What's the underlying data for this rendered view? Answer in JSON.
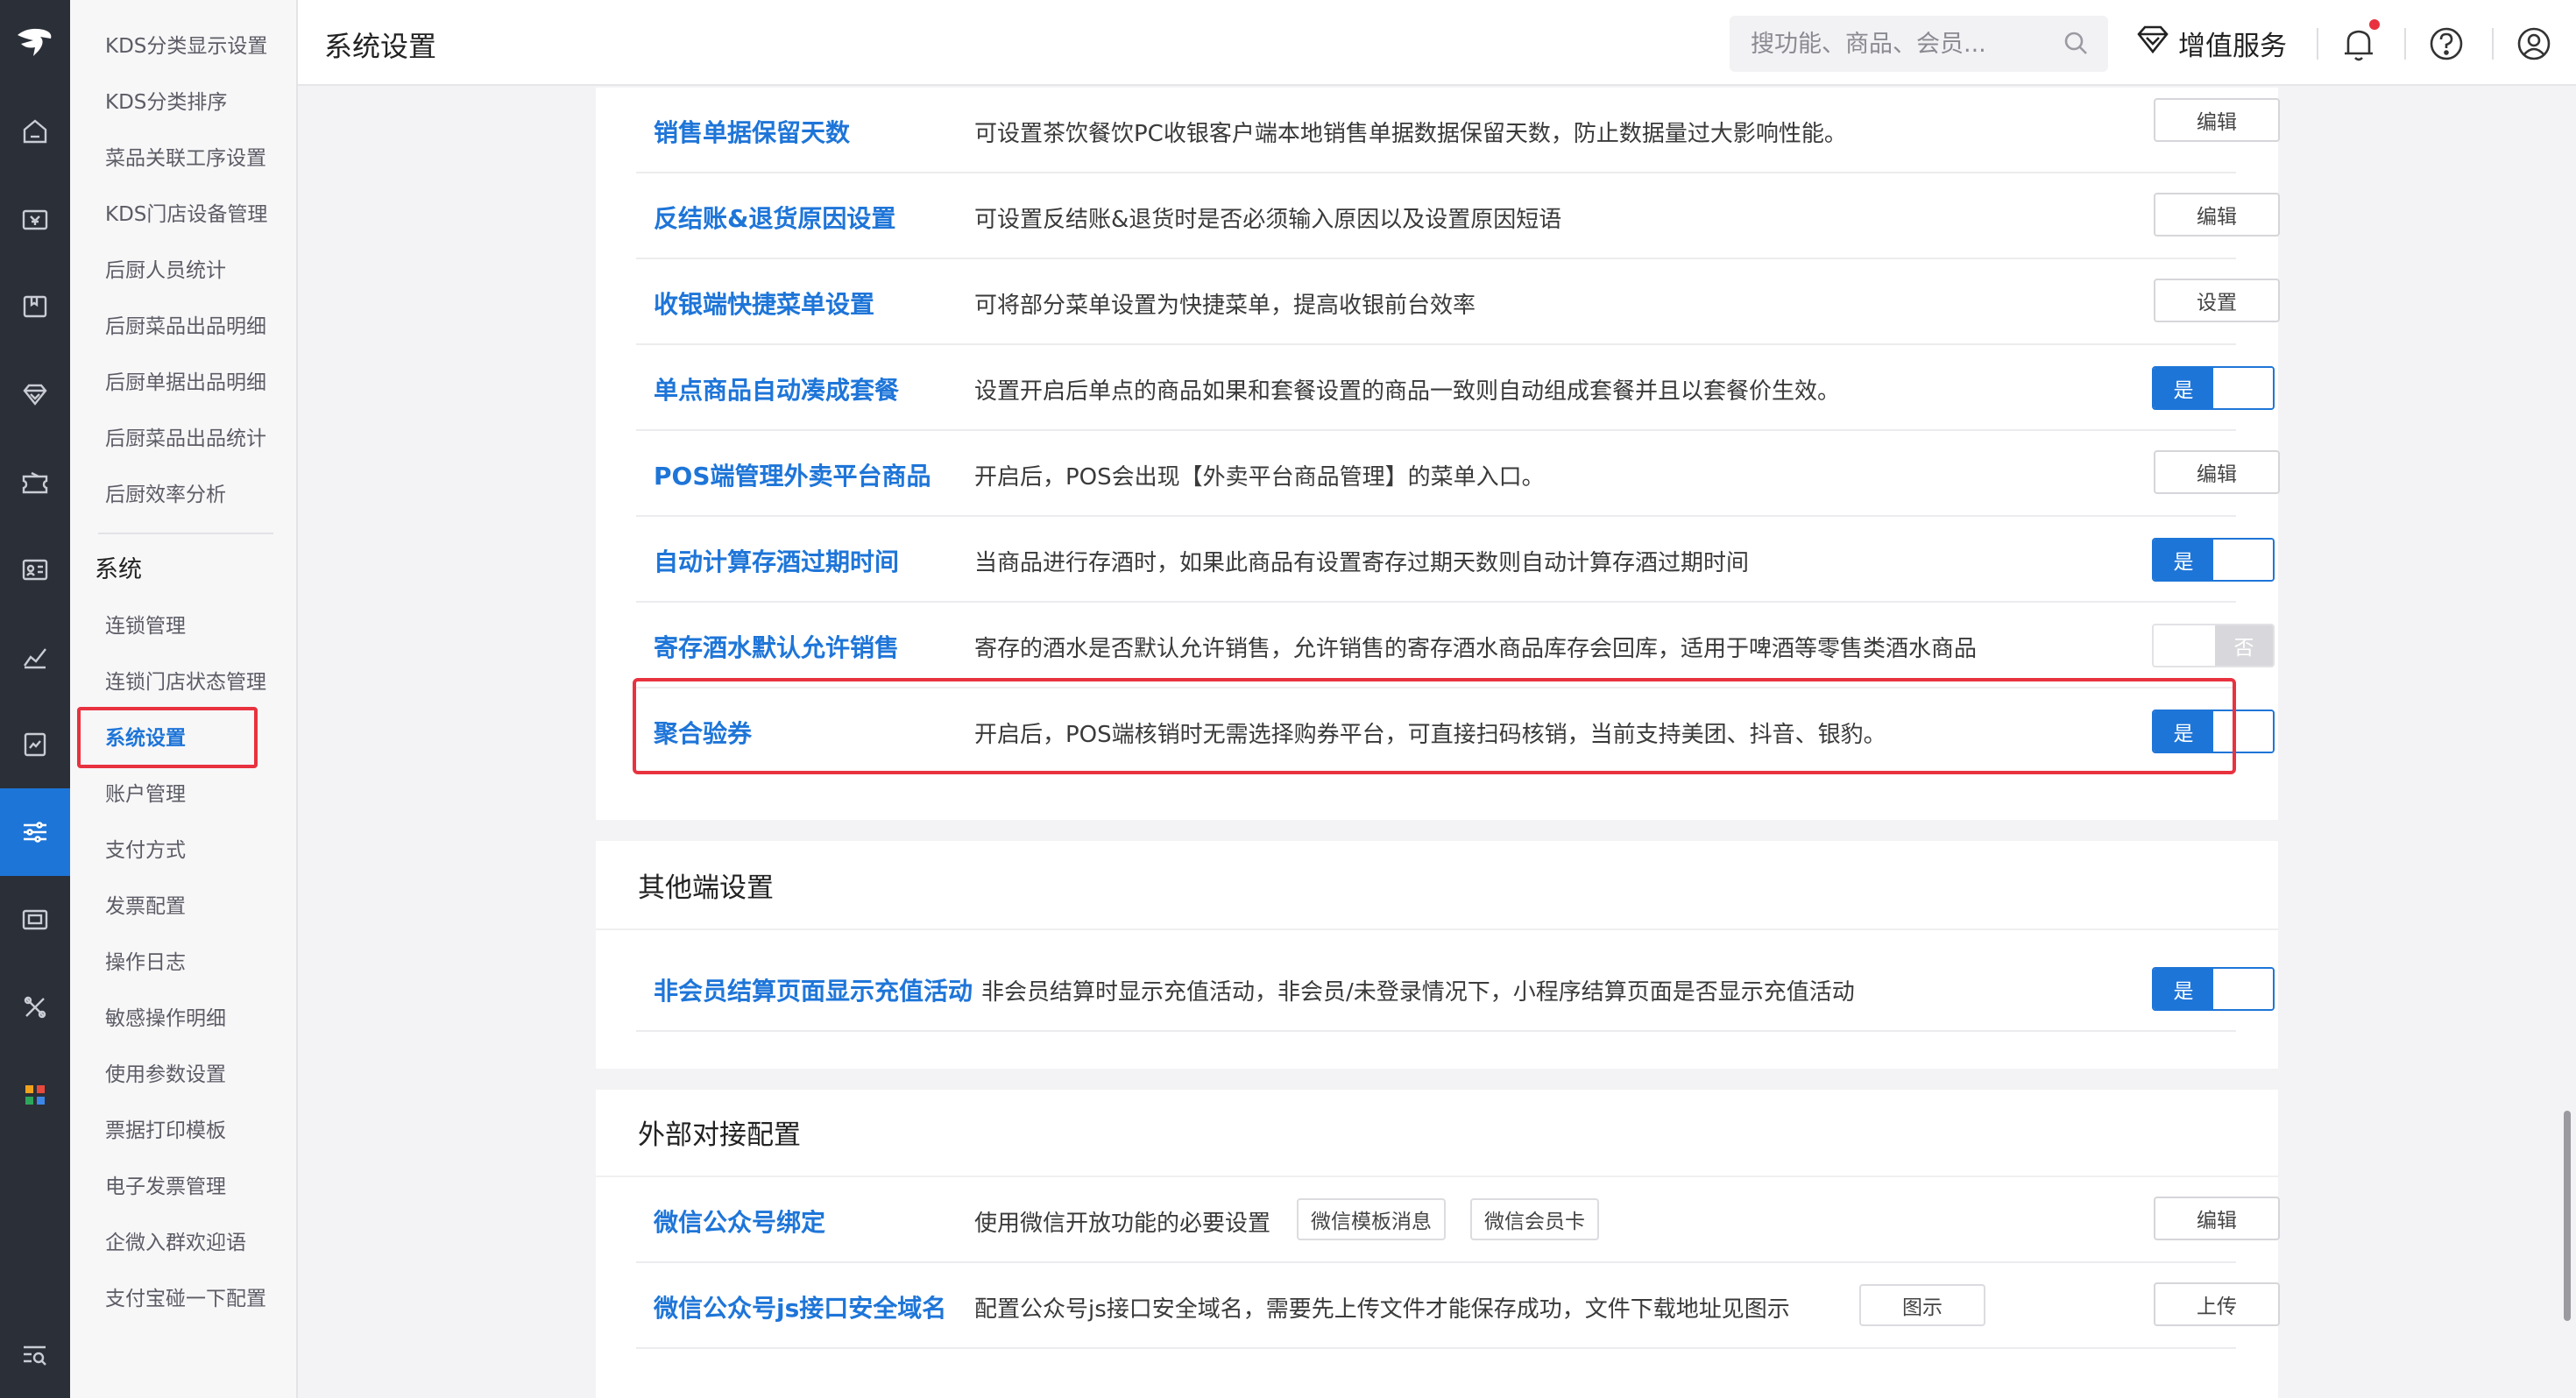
{
  "header": {
    "title": "系统设置",
    "search_placeholder": "搜功能、商品、会员...",
    "value_added_label": "增值服务"
  },
  "rail": {
    "icons": [
      "logo-icon",
      "home-icon",
      "cashier-icon",
      "menu-book-icon",
      "member-diamond-icon",
      "marketing-coupon-icon",
      "report-card-icon",
      "analytics-chart-icon",
      "finance-doc-icon",
      "settings-sliders-icon",
      "device-icon",
      "tools-icon",
      "apps-grid-icon",
      "search-list-icon"
    ]
  },
  "submenu": {
    "kitchen_items": [
      "KDS分类显示设置",
      "KDS分类排序",
      "菜品关联工序设置",
      "KDS门店设备管理",
      "后厨人员统计",
      "后厨菜品出品明细",
      "后厨单据出品明细",
      "后厨菜品出品统计",
      "后厨效率分析"
    ],
    "system_title": "系统",
    "system_items": [
      "连锁管理",
      "连锁门店状态管理",
      "系统设置",
      "账户管理",
      "支付方式",
      "发票配置",
      "操作日志",
      "敏感操作明细",
      "使用参数设置",
      "票据打印模板",
      "电子发票管理",
      "企微入群欢迎语",
      "支付宝碰一下配置"
    ],
    "active_item": "系统设置"
  },
  "settings_card": {
    "rows": [
      {
        "name": "销售单据保留天数",
        "desc": "可设置茶饮餐饮PC收银客户端本地销售单据数据保留天数，防止数据量过大影响性能。",
        "control": "button",
        "label": "编辑"
      },
      {
        "name": "反结账&退货原因设置",
        "desc": "可设置反结账&退货时是否必须输入原因以及设置原因短语",
        "control": "button",
        "label": "编辑"
      },
      {
        "name": "收银端快捷菜单设置",
        "desc": "可将部分菜单设置为快捷菜单，提高收银前台效率",
        "control": "button",
        "label": "设置"
      },
      {
        "name": "单点商品自动凑成套餐",
        "desc": "设置开启后单点的商品如果和套餐设置的商品一致则自动组成套餐并且以套餐价生效。",
        "control": "toggle_on",
        "label": "是"
      },
      {
        "name": "POS端管理外卖平台商品",
        "desc": "开启后，POS会出现【外卖平台商品管理】的菜单入口。",
        "control": "button",
        "label": "编辑"
      },
      {
        "name": "自动计算存酒过期时间",
        "desc": "当商品进行存酒时，如果此商品有设置寄存过期天数则自动计算存酒过期时间",
        "control": "toggle_on",
        "label": "是"
      },
      {
        "name": "寄存酒水默认允许销售",
        "desc": "寄存的酒水是否默认允许销售，允许销售的寄存酒水商品库存会回库，适用于啤酒等零售类酒水商品",
        "control": "toggle_off",
        "label": "否"
      },
      {
        "name": "聚合验券",
        "desc": "开启后，POS端核销时无需选择购券平台，可直接扫码核销，当前支持美团、抖音、银豹。",
        "control": "toggle_on",
        "label": "是"
      }
    ]
  },
  "other_card": {
    "title": "其他端设置",
    "rows": [
      {
        "name": "非会员结算页面显示充值活动",
        "desc": "非会员结算时显示充值活动，非会员/未登录情况下，小程序结算页面是否显示充值活动",
        "control": "toggle_on",
        "label": "是"
      }
    ]
  },
  "external_card": {
    "title": "外部对接配置",
    "rows": [
      {
        "name": "微信公众号绑定",
        "desc": "使用微信开放功能的必要设置",
        "tags": [
          "微信模板消息",
          "微信会员卡"
        ],
        "control": "button",
        "label": "编辑"
      },
      {
        "name": "微信公众号js接口安全域名",
        "desc": "配置公众号js接口安全域名，需要先上传文件才能保存成功，文件下载地址见图示",
        "tags": [
          "图示"
        ],
        "control": "button",
        "label": "上传"
      }
    ]
  },
  "colors": {
    "accent": "#1e75d8",
    "highlight": "#e8323f",
    "rail_bg": "#2b2f38"
  }
}
